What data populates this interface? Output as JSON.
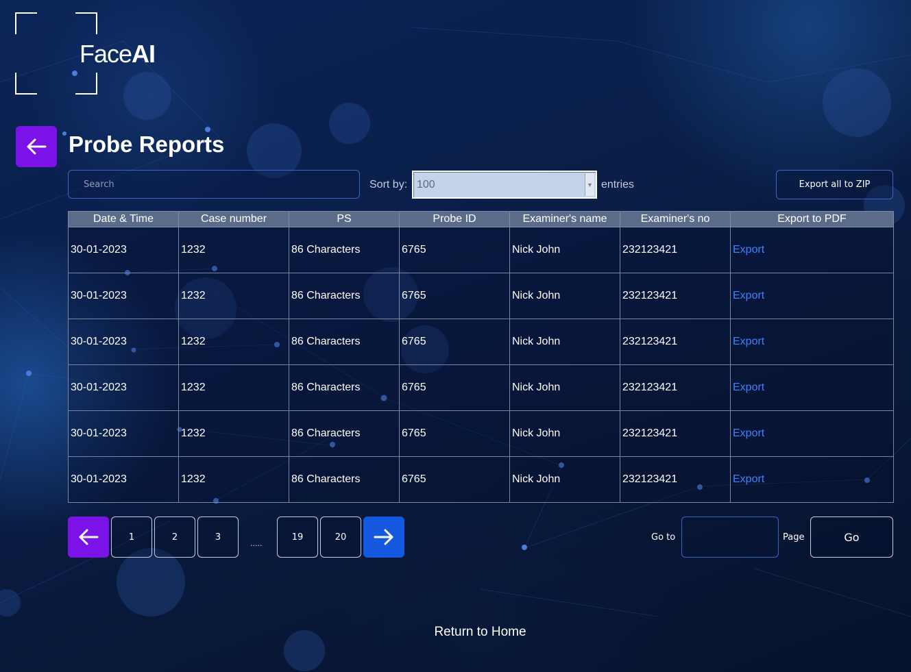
{
  "brand": {
    "name_light": "Face",
    "name_bold": "AI"
  },
  "header": {
    "title": "Probe Reports"
  },
  "toolbar": {
    "search_placeholder": "Search",
    "sort_label": "Sort by:",
    "sort_value": "100",
    "entries_label": "entries",
    "export_zip_label": "Export all to ZIP"
  },
  "table": {
    "columns": [
      "Date & Time",
      "Case number",
      "PS",
      "Probe ID",
      "Examiner's name",
      "Examiner's no",
      "Export to PDF"
    ],
    "rows": [
      [
        "30-01-2023",
        "1232",
        "86 Characters",
        "6765",
        "Nick John",
        "232123421",
        "Export"
      ],
      [
        "30-01-2023",
        "1232",
        "86 Characters",
        "6765",
        "Nick John",
        "232123421",
        "Export"
      ],
      [
        "30-01-2023",
        "1232",
        "86 Characters",
        "6765",
        "Nick John",
        "232123421",
        "Export"
      ],
      [
        "30-01-2023",
        "1232",
        "86 Characters",
        "6765",
        "Nick John",
        "232123421",
        "Export"
      ],
      [
        "30-01-2023",
        "1232",
        "86 Characters",
        "6765",
        "Nick John",
        "232123421",
        "Export"
      ],
      [
        "30-01-2023",
        "1232",
        "86 Characters",
        "6765",
        "Nick John",
        "232123421",
        "Export"
      ]
    ]
  },
  "pagination": {
    "pages": [
      "1",
      "2",
      "3",
      "19",
      "20"
    ],
    "ellipsis": ".....",
    "goto_label": "Go to",
    "page_label": "Page",
    "go_label": "Go"
  },
  "footer": {
    "return_home": "Return to Home"
  },
  "colors": {
    "accent_purple": "#7b12e8",
    "accent_blue": "#1559e0",
    "link_blue": "#3f82ff",
    "table_header": "#5b6b8a"
  },
  "icons": {
    "back": "arrow-left-icon",
    "prev": "arrow-left-icon",
    "next": "arrow-right-icon"
  }
}
